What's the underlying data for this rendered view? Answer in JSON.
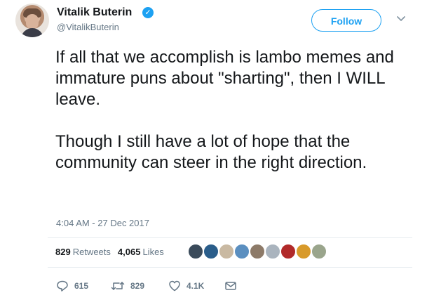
{
  "user": {
    "name": "Vitalik Buterin",
    "handle": "@VitalikButerin",
    "verified_glyph": "✓"
  },
  "follow_label": "Follow",
  "tweet": {
    "paragraphs": [
      "If all that we accomplish is lambo memes and immature puns about \"sharting\", then I WILL leave.",
      "Though I still have a lot of hope that the community can steer in the right direction."
    ],
    "timestamp": "4:04 AM - 27 Dec 2017"
  },
  "stats": {
    "retweets_count": "829",
    "retweets_label": "Retweets",
    "likes_count": "4,065",
    "likes_label": "Likes"
  },
  "liker_avatar_colors": [
    "#3a4a5a",
    "#2a5d8a",
    "#c9b9a2",
    "#5b8fc0",
    "#8d7a68",
    "#aab4be",
    "#b12a2a",
    "#d89a2a",
    "#9aa58c"
  ],
  "actions": {
    "reply_count": "615",
    "retweet_count": "829",
    "like_count": "4.1K"
  },
  "colors": {
    "accent": "#1da1f2",
    "secondary_text": "#657786",
    "primary_text": "#14171a"
  }
}
